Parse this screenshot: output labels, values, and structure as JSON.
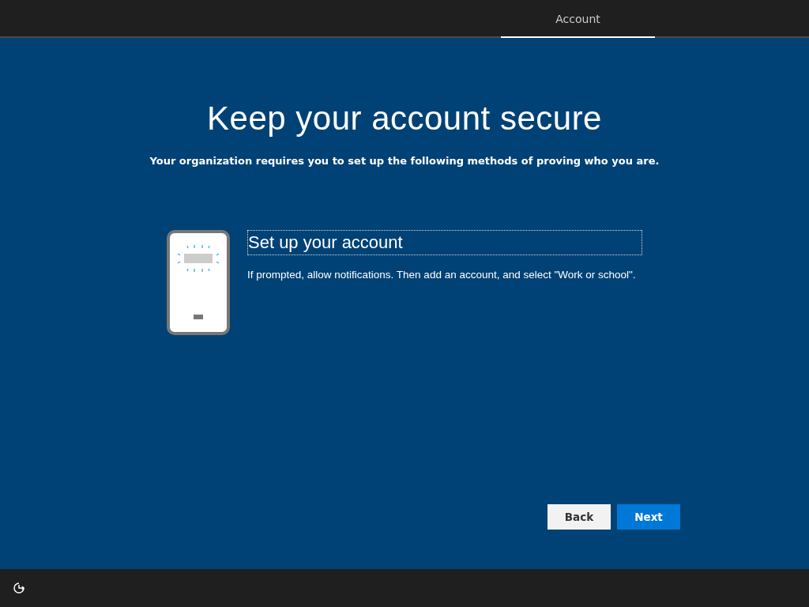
{
  "tabs": [
    {
      "label": "Account",
      "selected": true
    }
  ],
  "title": "Keep your account secure",
  "subtitle": "Your organization requires you to set up the following methods of proving who you are.",
  "method": {
    "heading": "Set up your account",
    "description": "If prompted, allow notifications. Then add an account, and select \"Work or school\"."
  },
  "buttons": [
    {
      "label": "Back",
      "kind": "secondary"
    },
    {
      "label": "Next",
      "kind": "primary"
    }
  ]
}
